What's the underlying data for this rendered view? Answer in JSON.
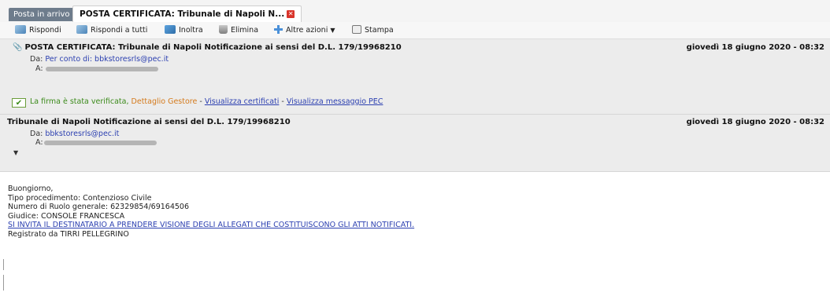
{
  "tabs": {
    "inbox": "Posta in arrivo",
    "message": "POSTA CERTIFICATA: Tribunale di Napoli N...",
    "close_glyph": "✕"
  },
  "toolbar": {
    "reply": "Rispondi",
    "reply_all": "Rispondi a tutti",
    "forward": "Inoltra",
    "delete": "Elimina",
    "more_actions": "Altre azioni",
    "more_caret": "▼",
    "print": "Stampa"
  },
  "pec_message": {
    "subject": "POSTA CERTIFICATA: Tribunale di Napoli Notificazione ai sensi del D.L. 179/19968210",
    "date": "giovedì 18 giugno 2020 - 08:32",
    "from_label": "Da:",
    "from_value": "Per conto di: bbkstoresrls@pec.it",
    "to_label": "A:",
    "signature": {
      "check_glyph": "✔",
      "verified": "La firma è stata verificata,",
      "details": "Dettaglio Gestore",
      "sep1": "-",
      "view_certs": "Visualizza certificati",
      "sep2": "-",
      "view_pec": "Visualizza messaggio PEC"
    }
  },
  "inner_message": {
    "subject": "Tribunale di Napoli Notificazione ai sensi del D.L. 179/19968210",
    "date": "giovedì 18 giugno 2020 - 08:32",
    "from_label": "Da:",
    "from_value": "bbkstoresrls@pec.it",
    "to_label": "A:",
    "expand_glyph": "▼"
  },
  "body": {
    "greeting": "Buongiorno,",
    "line1": "Tipo procedimento: Contenzioso Civile",
    "line2": "Numero di Ruolo generale: 62329854/69164506",
    "line3": "Giudice: CONSOLE FRANCESCA",
    "link": "SI INVITA IL DESTINATARIO A PRENDERE VISIONE DEGLI ALLEGATI CHE COSTITUISCONO GLI ATTI NOTIFICATI.",
    "line4": "Registrato da TIRRI PELLEGRINO"
  },
  "icons": {
    "reply": "reply-icon",
    "reply_all": "reply-all-icon",
    "forward": "forward-icon",
    "delete": "trash-icon",
    "more": "plus-icon",
    "print": "print-icon",
    "attachment": "paperclip-icon",
    "signature": "checkmark-icon"
  },
  "colors": {
    "link": "#2b3fb0",
    "verified": "#3b8a1a",
    "gestore": "#d47a1c",
    "close": "#d9342b",
    "header_bg": "#ececec"
  }
}
